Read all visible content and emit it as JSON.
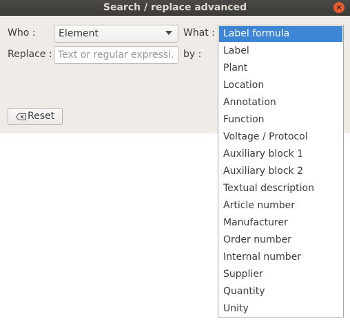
{
  "window": {
    "title": "Search / replace advanced",
    "close_glyph": "×"
  },
  "who": {
    "label": "Who :",
    "value": "Element"
  },
  "what": {
    "label": "What :"
  },
  "replace": {
    "label": "Replace :",
    "placeholder": "Text or regular expressi..."
  },
  "by": {
    "label": "by :"
  },
  "reset": {
    "label": "Reset",
    "icon": "backspace-clear-icon"
  },
  "dropdown": {
    "selected_index": 0,
    "options": [
      "Label formula",
      "Label",
      "Plant",
      "Location",
      "Annotation",
      "Function",
      "Voltage / Protocol",
      "Auxiliary block 1",
      "Auxiliary block 2",
      "Textual description",
      "Article number",
      "Manufacturer",
      "Order number",
      "Internal number",
      "Supplier",
      "Quantity",
      "Unity"
    ]
  },
  "colors": {
    "titlebar": "#3c3b37",
    "dialog_bg": "#efebe7",
    "selection": "#3d86d6",
    "close_button": "#e35d2f"
  }
}
